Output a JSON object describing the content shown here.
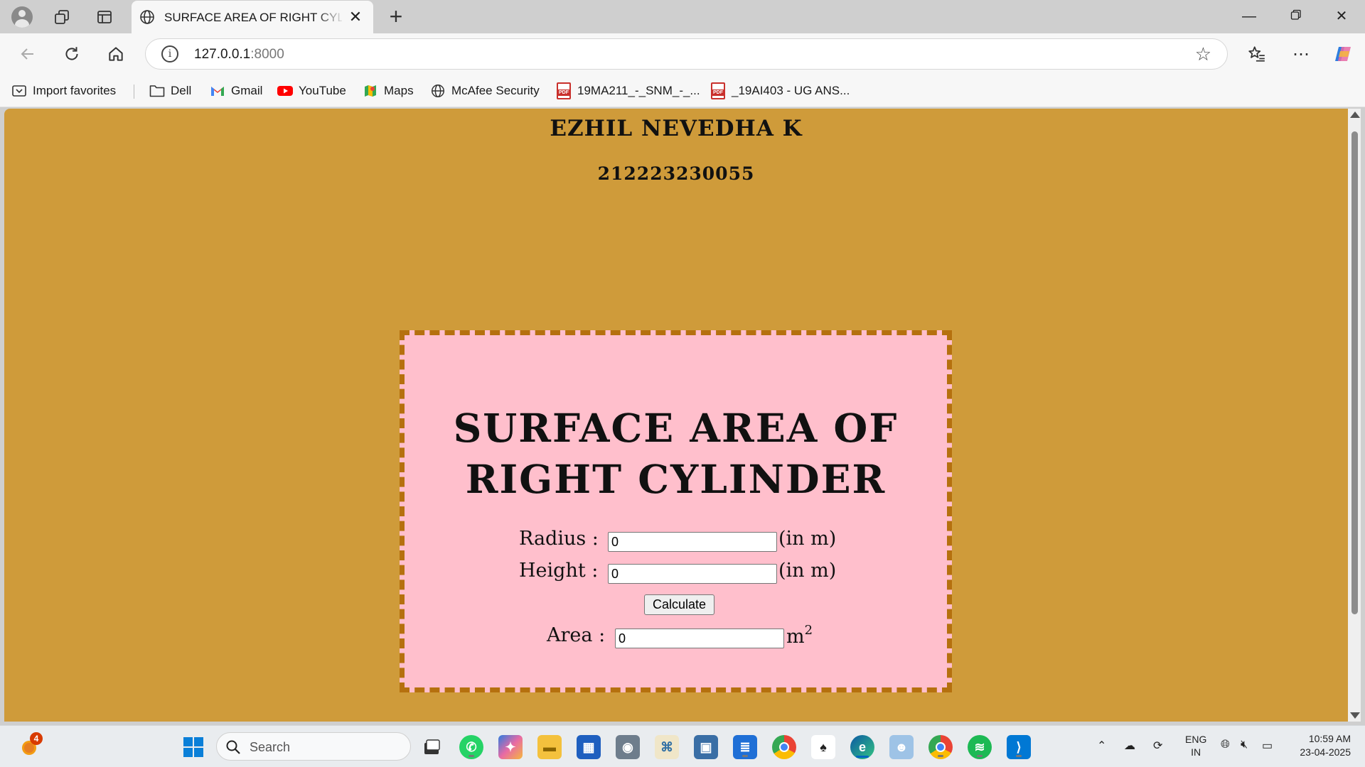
{
  "browser": {
    "tab_title": "SURFACE AREA OF RIGHT CYLINDER",
    "url_host": "127.0.0.1",
    "url_port": ":8000",
    "favorites": [
      {
        "label": "Import favorites",
        "icon": "import-icon"
      },
      {
        "label": "Dell",
        "icon": "folder-icon"
      },
      {
        "label": "Gmail",
        "icon": "gmail-icon"
      },
      {
        "label": "YouTube",
        "icon": "youtube-icon"
      },
      {
        "label": "Maps",
        "icon": "maps-icon"
      },
      {
        "label": "McAfee Security",
        "icon": "globe-icon"
      },
      {
        "label": "19MA211_-_SNM_-_...",
        "icon": "pdf-icon"
      },
      {
        "label": "_19AI403 - UG ANS...",
        "icon": "pdf-icon"
      }
    ]
  },
  "page": {
    "name": "EZHIL NEVEDHA K",
    "id": "212223230055",
    "title_line1": "SURFACE AREA OF",
    "title_line2": "RIGHT CYLINDER",
    "radius_label": "Radius :",
    "radius_value": "0",
    "radius_unit": "(in m)",
    "height_label": "Height :",
    "height_value": "0",
    "height_unit": "(in m)",
    "calculate_label": "Calculate",
    "area_label": "Area :",
    "area_value": "0",
    "area_unit": "m",
    "area_unit_power": "2",
    "colors": {
      "page_background": "#cf9b3a",
      "card_background": "#ffbfcc",
      "card_border": "#b5700e"
    }
  },
  "taskbar": {
    "search_placeholder": "Search",
    "notification_count": "4",
    "language_line1": "ENG",
    "language_line2": "IN",
    "time": "10:59 AM",
    "date": "23-04-2025"
  }
}
